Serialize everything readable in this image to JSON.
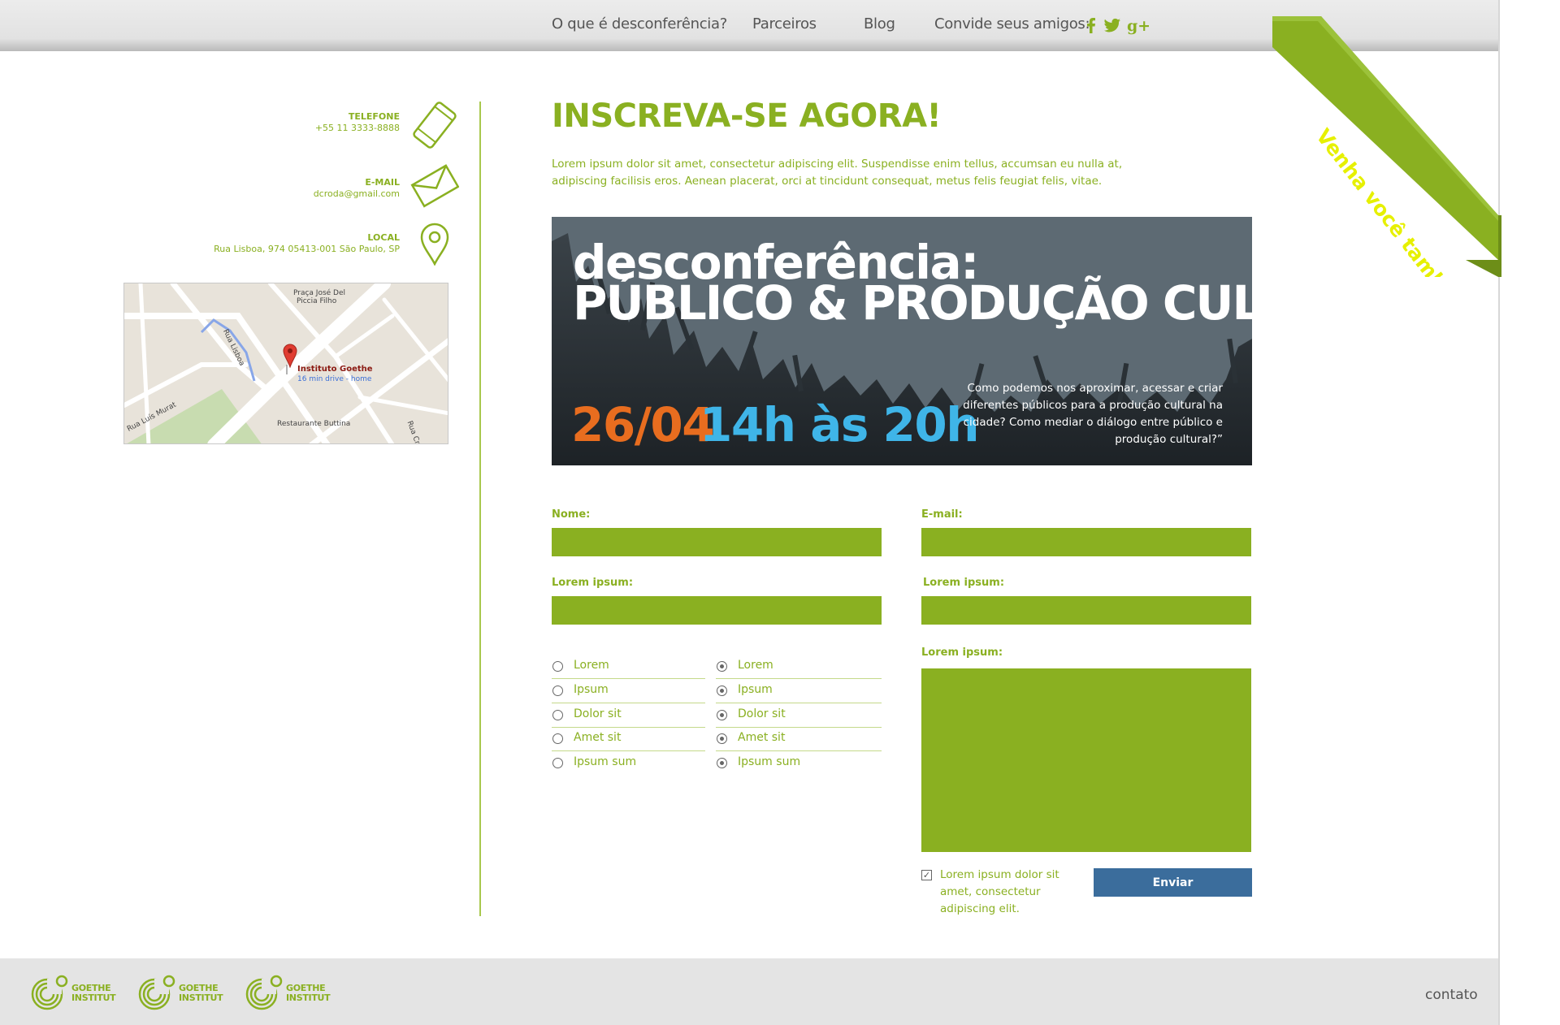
{
  "nav": {
    "items": [
      "O que é desconferência?",
      "Parceiros",
      "Blog"
    ],
    "invite_label": "Convide seus amigos:",
    "social_icons": [
      "facebook-icon",
      "twitter-icon",
      "google-plus-icon"
    ]
  },
  "ribbon": {
    "text": "Venha você também!"
  },
  "contact": {
    "phone_label": "TELEFONE",
    "phone_value": "+55 11 3333-8888",
    "email_label": "E-MAIL",
    "email_value": "dcroda@gmail.com",
    "local_label": "LOCAL",
    "local_value": "Rua Lisboa, 974 05413-001 São Paulo, SP",
    "icons": [
      "phone-icon",
      "mail-icon",
      "location-pin-icon"
    ]
  },
  "map": {
    "place_name": "Instituto Goethe",
    "place_sub": "16 min drive - home",
    "labels": [
      "Praça José Del",
      "Piccia Filho",
      "Rua Lisboa",
      "Rua Luís Murat",
      "Restaurante Buttina",
      "Rua Cr"
    ]
  },
  "main": {
    "title": "INSCREVA-SE AGORA!",
    "intro": "Lorem ipsum dolor sit amet, consectetur adipiscing elit. Suspendisse enim tellus, accumsan eu nulla at, adipiscing facilisis eros. Aenean placerat, orci at tincidunt consequat, metus felis feugiat felis, vitae."
  },
  "banner": {
    "title_line1": "desconferência:",
    "title_line2": "PÚBLICO & PRODUÇÃO CULTURAL",
    "date": "26/04",
    "time": "14h às 20h",
    "quote": "Como podemos nos aproximar, acessar e criar diferentes públicos para a produção cultural na cidade? Como mediar o diálogo entre público e produção cultural?”"
  },
  "form": {
    "name_label": "Nome:",
    "email_label": "E-mail:",
    "field3_label": "Lorem ipsum:",
    "field4_label": "Lorem ipsum:",
    "message_label": "Lorem ipsum:",
    "options_left": [
      "Lorem",
      "Ipsum",
      "Dolor sit",
      "Amet sit",
      "Ipsum sum"
    ],
    "options_right": [
      "Lorem",
      "Ipsum",
      "Dolor sit",
      "Amet sit",
      "Ipsum sum"
    ],
    "agree_text": "Lorem ipsum dolor sit amet, consectetur adipiscing elit.",
    "submit_label": "Enviar"
  },
  "footer": {
    "logo_text_line1": "GOETHE",
    "logo_text_line2": "INSTITUT",
    "contact_link": "contato"
  },
  "colors": {
    "accent": "#8ab021",
    "banner_bg": "#5d6a73",
    "date": "#e86d1f",
    "time": "#3fb5e8",
    "button": "#3b6d9c",
    "ribbon_text": "#e6f000"
  }
}
